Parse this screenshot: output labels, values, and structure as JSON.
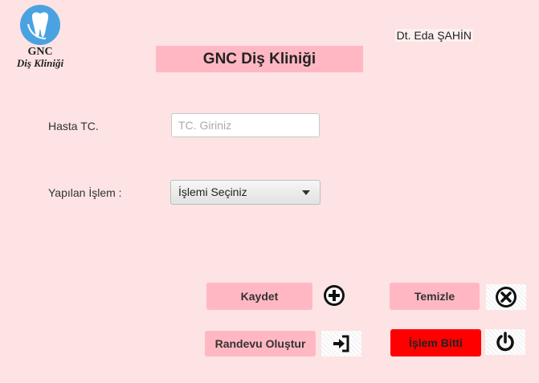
{
  "logo": {
    "line1": "GNC",
    "line2": "Diş Kliniği"
  },
  "doctor_name": "Dt. Eda ŞAHİN",
  "title": "GNC Diş Kliniği",
  "form": {
    "tc_label": "Hasta TC.",
    "tc_placeholder": "TC. Giriniz",
    "tc_value": "",
    "islem_label": "Yapılan İşlem :",
    "islem_selected": "İşlemi Seçiniz"
  },
  "buttons": {
    "kaydet": "Kaydet",
    "temizle": "Temizle",
    "randevu": "Randevu Oluştur",
    "islem_bitti": "İşlem Bitti"
  },
  "icons": {
    "add": "plus-circle-icon",
    "clear": "x-circle-icon",
    "appointment": "sign-in-icon",
    "finish": "power-icon",
    "logo": "tooth-icon"
  },
  "colors": {
    "background": "#fde3e3",
    "title_bg": "#ffb8c3",
    "button_bg": "#ffb8c3",
    "finish_button_bg": "#ff0000",
    "logo_accent": "#4aa3e0"
  }
}
